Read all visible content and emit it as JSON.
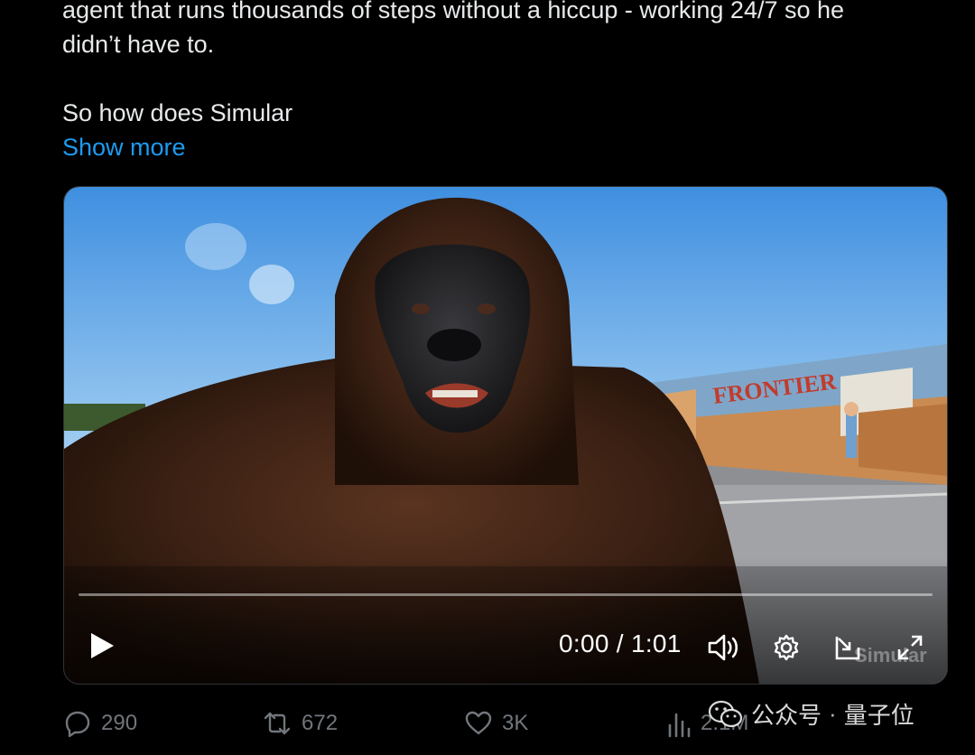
{
  "tweet": {
    "line1": "agent that runs thousands of steps without a hiccup - working 24/7 so he",
    "line2": "didn’t have to.",
    "line3": "So how does Simular",
    "show_more": "Show more"
  },
  "video": {
    "current_time": "0:00",
    "separator": "/",
    "duration": "1:01",
    "progress": 0,
    "mural_text": "FRONTIER",
    "watermark": "Simular",
    "icons": {
      "play": "play-icon",
      "volume": "volume-icon",
      "settings": "gear-icon",
      "pip": "picture-in-picture-icon",
      "fullscreen": "fullscreen-icon"
    }
  },
  "actions": {
    "replies": "290",
    "retweets": "672",
    "likes": "3K",
    "views": "2.1M"
  },
  "overlay_watermark": {
    "app": "公众号",
    "dot": "·",
    "name": "量子位"
  },
  "colors": {
    "background": "#000000",
    "text": "#e7e9ea",
    "link": "#1d9bf0",
    "muted": "#71767b",
    "sky": "#4f9be0"
  }
}
